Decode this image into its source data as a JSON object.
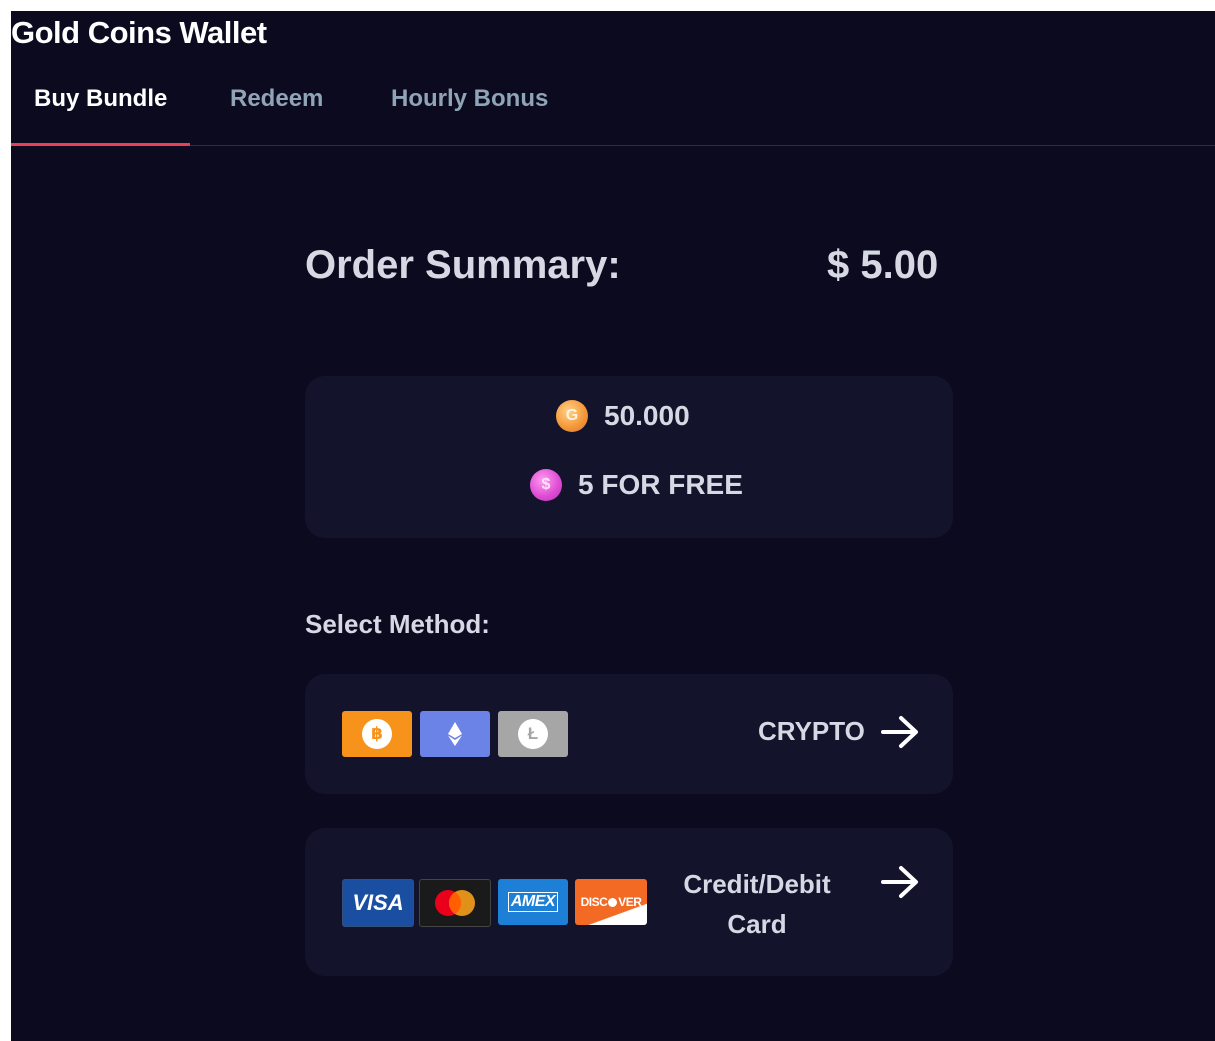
{
  "app": {
    "title": "Gold Coins Wallet"
  },
  "tabs": [
    {
      "label": "Buy Bundle",
      "active": true
    },
    {
      "label": "Redeem",
      "active": false
    },
    {
      "label": "Hourly Bonus",
      "active": false
    }
  ],
  "order": {
    "label": "Order Summary:",
    "amount": "$ 5.00"
  },
  "bundle": {
    "gold_amount": "50.000",
    "gold_icon": "gold-coin-icon",
    "bonus_text": "5 FOR FREE",
    "bonus_icon": "sweeps-coin-icon"
  },
  "methods": {
    "title": "Select Method:",
    "crypto": {
      "label": "CRYPTO",
      "icons": [
        "bitcoin-icon",
        "ethereum-icon",
        "litecoin-icon"
      ]
    },
    "card": {
      "label_line1": "Credit/Debit",
      "label_line2": "Card",
      "icons": [
        "visa-icon",
        "mastercard-icon",
        "amex-icon",
        "discover-icon"
      ],
      "brand_text": {
        "visa": "VISA",
        "amex": "AMEX",
        "discover": "DISC",
        "discover_tail": "VER"
      }
    }
  },
  "colors": {
    "background": "#0b0a1f",
    "card": "#13132b",
    "accent": "#e8405b",
    "bitcoin": "#f7931a",
    "ethereum": "#6b82e6",
    "litecoin": "#a6a6a6",
    "visa": "#1a4ea1",
    "amex": "#1e7fd6",
    "discover": "#f26a23"
  }
}
